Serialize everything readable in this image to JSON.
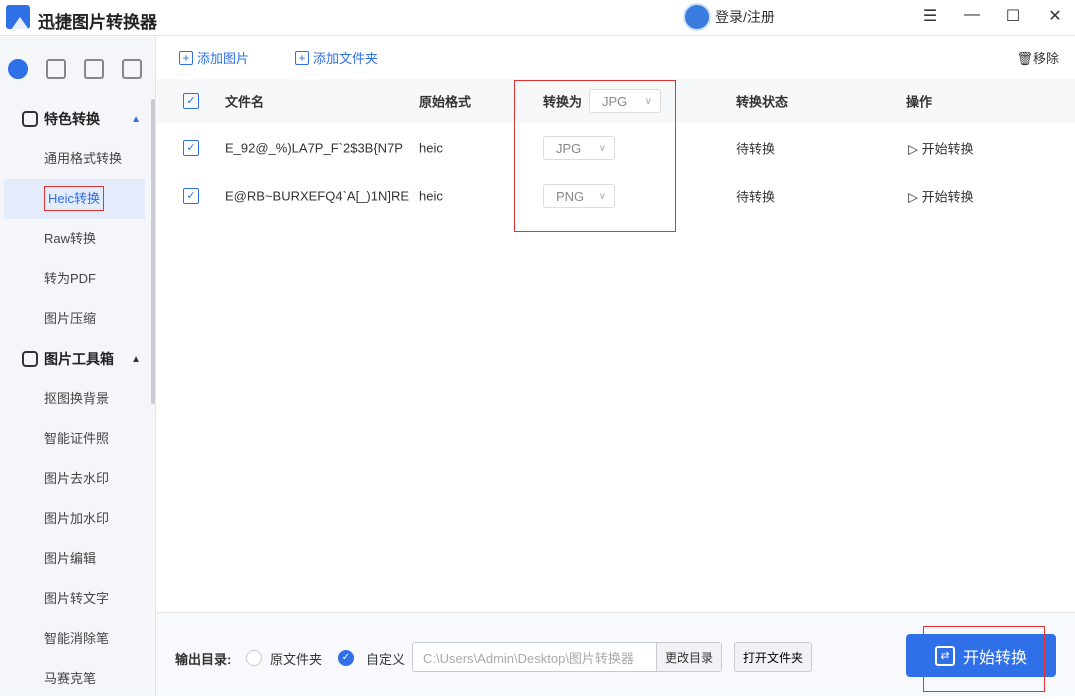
{
  "app": {
    "title": "迅捷图片转换器",
    "user_label": "登录/注册"
  },
  "sidebar": {
    "groups": [
      {
        "label": "特色转换",
        "items": [
          "通用格式转换",
          "Heic转换",
          "Raw转换",
          "转为PDF",
          "图片压缩"
        ]
      },
      {
        "label": "图片工具箱",
        "items": [
          "抠图换背景",
          "智能证件照",
          "图片去水印",
          "图片加水印",
          "图片编辑",
          "图片转文字",
          "智能消除笔",
          "马赛克笔"
        ]
      }
    ],
    "selected": "Heic转换"
  },
  "toolbar": {
    "add_image": "添加图片",
    "add_folder": "添加文件夹",
    "remove": "移除"
  },
  "table": {
    "headers": {
      "name": "文件名",
      "format": "原始格式",
      "convert_to": "转换为",
      "status": "转换状态",
      "action": "操作"
    },
    "convert_all": "JPG",
    "rows": [
      {
        "name": "E_92@_%)LA7P_F`2$3B{N7P",
        "format": "heic",
        "target": "JPG",
        "status": "待转换",
        "action": "开始转换"
      },
      {
        "name": "E@RB~BURXEFQ4`A[_)1N]RE",
        "format": "heic",
        "target": "PNG",
        "status": "待转换",
        "action": "开始转换"
      }
    ]
  },
  "bottom": {
    "output_label": "输出目录:",
    "opt_original": "原文件夹",
    "opt_custom": "自定义",
    "path": "C:\\Users\\Admin\\Desktop\\图片转换器",
    "change_dir": "更改目录",
    "open_folder": "打开文件夹",
    "start": "开始转换"
  }
}
